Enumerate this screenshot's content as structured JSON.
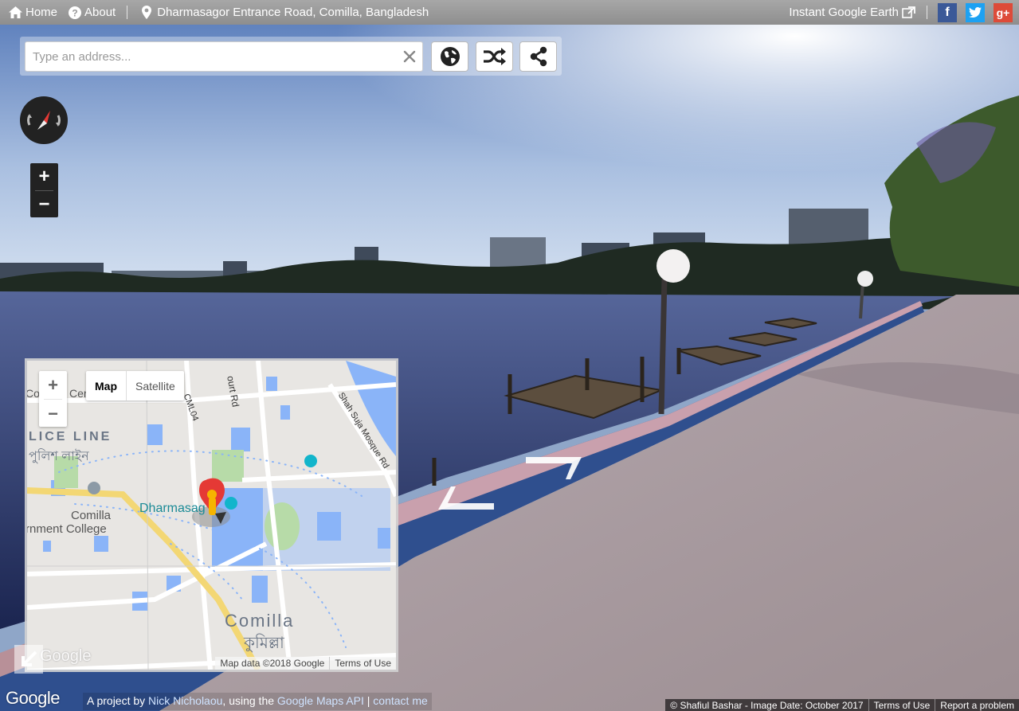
{
  "topbar": {
    "home_label": "Home",
    "about_label": "About",
    "location": "Dharmasagor Entrance Road, Comilla, Bangladesh",
    "instant_earth_label": "Instant Google Earth",
    "social": [
      {
        "name": "facebook",
        "glyph": "f",
        "color": "#3b5998"
      },
      {
        "name": "twitter",
        "glyph": "t",
        "color": "#1da1f2"
      },
      {
        "name": "google-plus",
        "glyph": "g+",
        "color": "#dd4b39"
      }
    ]
  },
  "search": {
    "placeholder": "Type an address...",
    "value": "",
    "buttons": [
      "globe-icon",
      "shuffle-icon",
      "share-icon"
    ]
  },
  "streetview": {
    "zoom_in": "+",
    "zoom_out": "−",
    "photo_credit": "© Shafiul Bashar - Image Date: October 2017",
    "terms_label": "Terms of Use",
    "report_label": "Report a problem"
  },
  "minimap": {
    "zoom_in": "+",
    "zoom_out": "−",
    "map_type_map": "Map",
    "map_type_satellite": "Satellite",
    "labels": {
      "cer": "Cer",
      "co": "Co",
      "police_line": "LICE LINE",
      "police_line_bn": "পুলিশ লাইন",
      "court_rd": "ourt Rd",
      "cml04": "CML04",
      "shah_suja": "Shah Suja Mosque Rd",
      "dharmasagor": "Dharmasag",
      "comilla_college_1": "Comilla",
      "comilla_college_2": "rnment College",
      "comilla": "Comilla",
      "comilla_bn": "কুমিল্লা",
      "google": "Google"
    },
    "map_data": "Map data ©2018 Google",
    "terms_label": "Terms of Use"
  },
  "footer": {
    "google_logo": "Google",
    "credit_prefix": "A project by",
    "author": "Nick Nicholaou",
    "credit_mid": ", using the",
    "api_label": "Google Maps API",
    "separator": "|",
    "contact_label": "contact me"
  },
  "colors": {
    "topbar_bg": "#9b9b9b",
    "link_blue": "#cfe3ff",
    "water": "#2c3a6a",
    "wall_blue": "#2f4f8e",
    "map_water_blue": "#8ab4f8"
  }
}
